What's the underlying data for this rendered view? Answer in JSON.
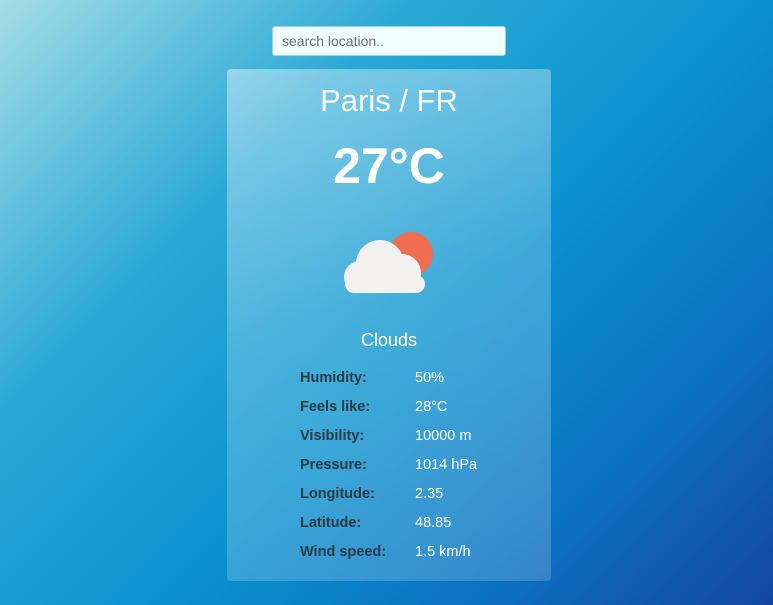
{
  "search": {
    "placeholder": "search location..",
    "value": ""
  },
  "weather": {
    "location": "Paris / FR",
    "temperature": "27°C",
    "condition": "Clouds",
    "icon": "cloud-sun-icon"
  },
  "details": [
    {
      "label": "Humidity:",
      "value": "50%"
    },
    {
      "label": "Feels like:",
      "value": "28°C"
    },
    {
      "label": "Visibility:",
      "value": "10000 m"
    },
    {
      "label": "Pressure:",
      "value": "1014 hPa"
    },
    {
      "label": "Longitude:",
      "value": "2.35"
    },
    {
      "label": "Latitude:",
      "value": "48.85"
    },
    {
      "label": "Wind speed:",
      "value": "1.5 km/h"
    }
  ],
  "colors": {
    "sun": "#ee6e4f",
    "cloud": "#f3f1ef",
    "label_text": "#2b3a44"
  }
}
